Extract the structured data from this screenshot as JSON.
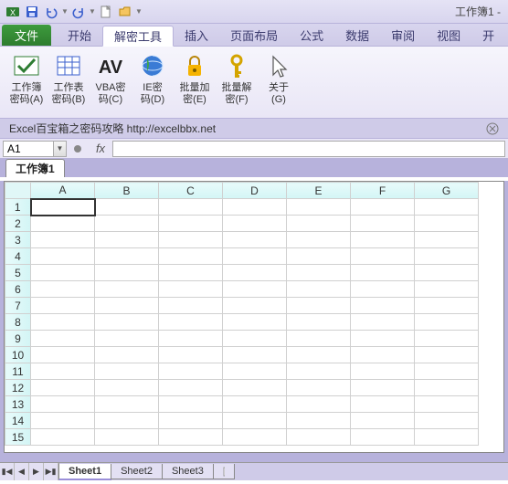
{
  "title": "工作簿1 - ",
  "tabs": {
    "file": "文件",
    "list": [
      "开始",
      "解密工具",
      "插入",
      "页面布局",
      "公式",
      "数据",
      "审阅",
      "视图",
      "开"
    ],
    "active_index": 1
  },
  "ribbon_items": [
    {
      "label": "工作簿\n密码(A)"
    },
    {
      "label": "工作表\n密码(B)"
    },
    {
      "label": "VBA密\n码(C)"
    },
    {
      "label": "IE密\n码(D)"
    },
    {
      "label": "批量加\n密(E)"
    },
    {
      "label": "批量解\n密(F)"
    },
    {
      "label": "关于\n(G)"
    }
  ],
  "infobar": {
    "text": "Excel百宝箱之密码攻略   http://excelbbx.net"
  },
  "namebox": "A1",
  "fx": "fx",
  "workbook_tab": "工作簿1",
  "columns": [
    "A",
    "B",
    "C",
    "D",
    "E",
    "F",
    "G"
  ],
  "rows": [
    "1",
    "2",
    "3",
    "4",
    "5",
    "6",
    "7",
    "8",
    "9",
    "10",
    "11",
    "12",
    "13",
    "14",
    "15"
  ],
  "sheets": [
    "Sheet1",
    "Sheet2",
    "Sheet3"
  ],
  "active_sheet": 0
}
